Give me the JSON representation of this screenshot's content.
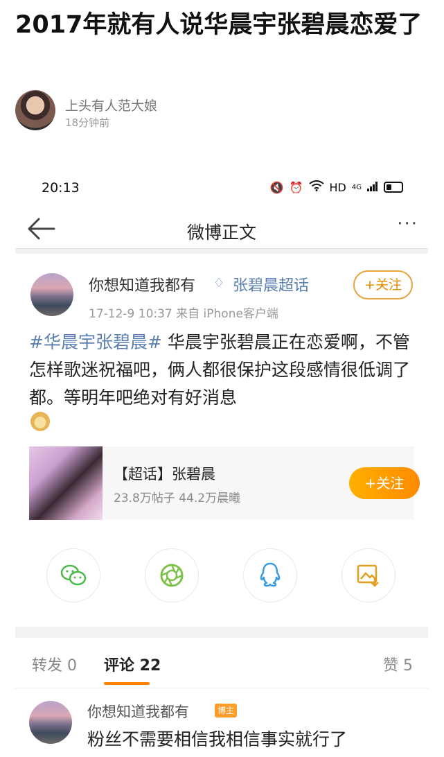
{
  "article": {
    "title": "2017年就有人说华晨宇张碧晨恋爱了",
    "author": "上头有人范大娘",
    "time": "18分钟前"
  },
  "status_bar": {
    "time": "20:13",
    "network": "HD",
    "signal": "4G"
  },
  "navbar": {
    "title": "微博正文",
    "more": "···"
  },
  "post": {
    "user": "你想知道我都有",
    "topic": "张碧晨超话",
    "follow": "+关注",
    "meta": "17-12-9 10:37  来自 iPhone客户端",
    "hashtag": "#华晨宇张碧晨#",
    "text": " 华晨宇张碧晨正在恋爱啊，不管怎样歌迷祝福吧，俩人都很保护这段感情很低调了都。等明年吧绝对有好消息",
    "card": {
      "title": "【超话】张碧晨",
      "stats": "23.8万帖子 44.2万晨曦",
      "follow": "+关注"
    }
  },
  "share": [
    {
      "icon": "wechat-icon"
    },
    {
      "icon": "moments-icon"
    },
    {
      "icon": "qq-icon"
    },
    {
      "icon": "save-image-icon"
    }
  ],
  "tabs": {
    "repost": "转发 0",
    "comments": "评论 22",
    "likes": "赞 5"
  },
  "comment": {
    "user": "你想知道我都有",
    "badge": "博主",
    "text": "粉丝不需要相信我相信事实就行了"
  },
  "colors": {
    "accent": "#ff8200",
    "link": "#5a7fb0"
  }
}
